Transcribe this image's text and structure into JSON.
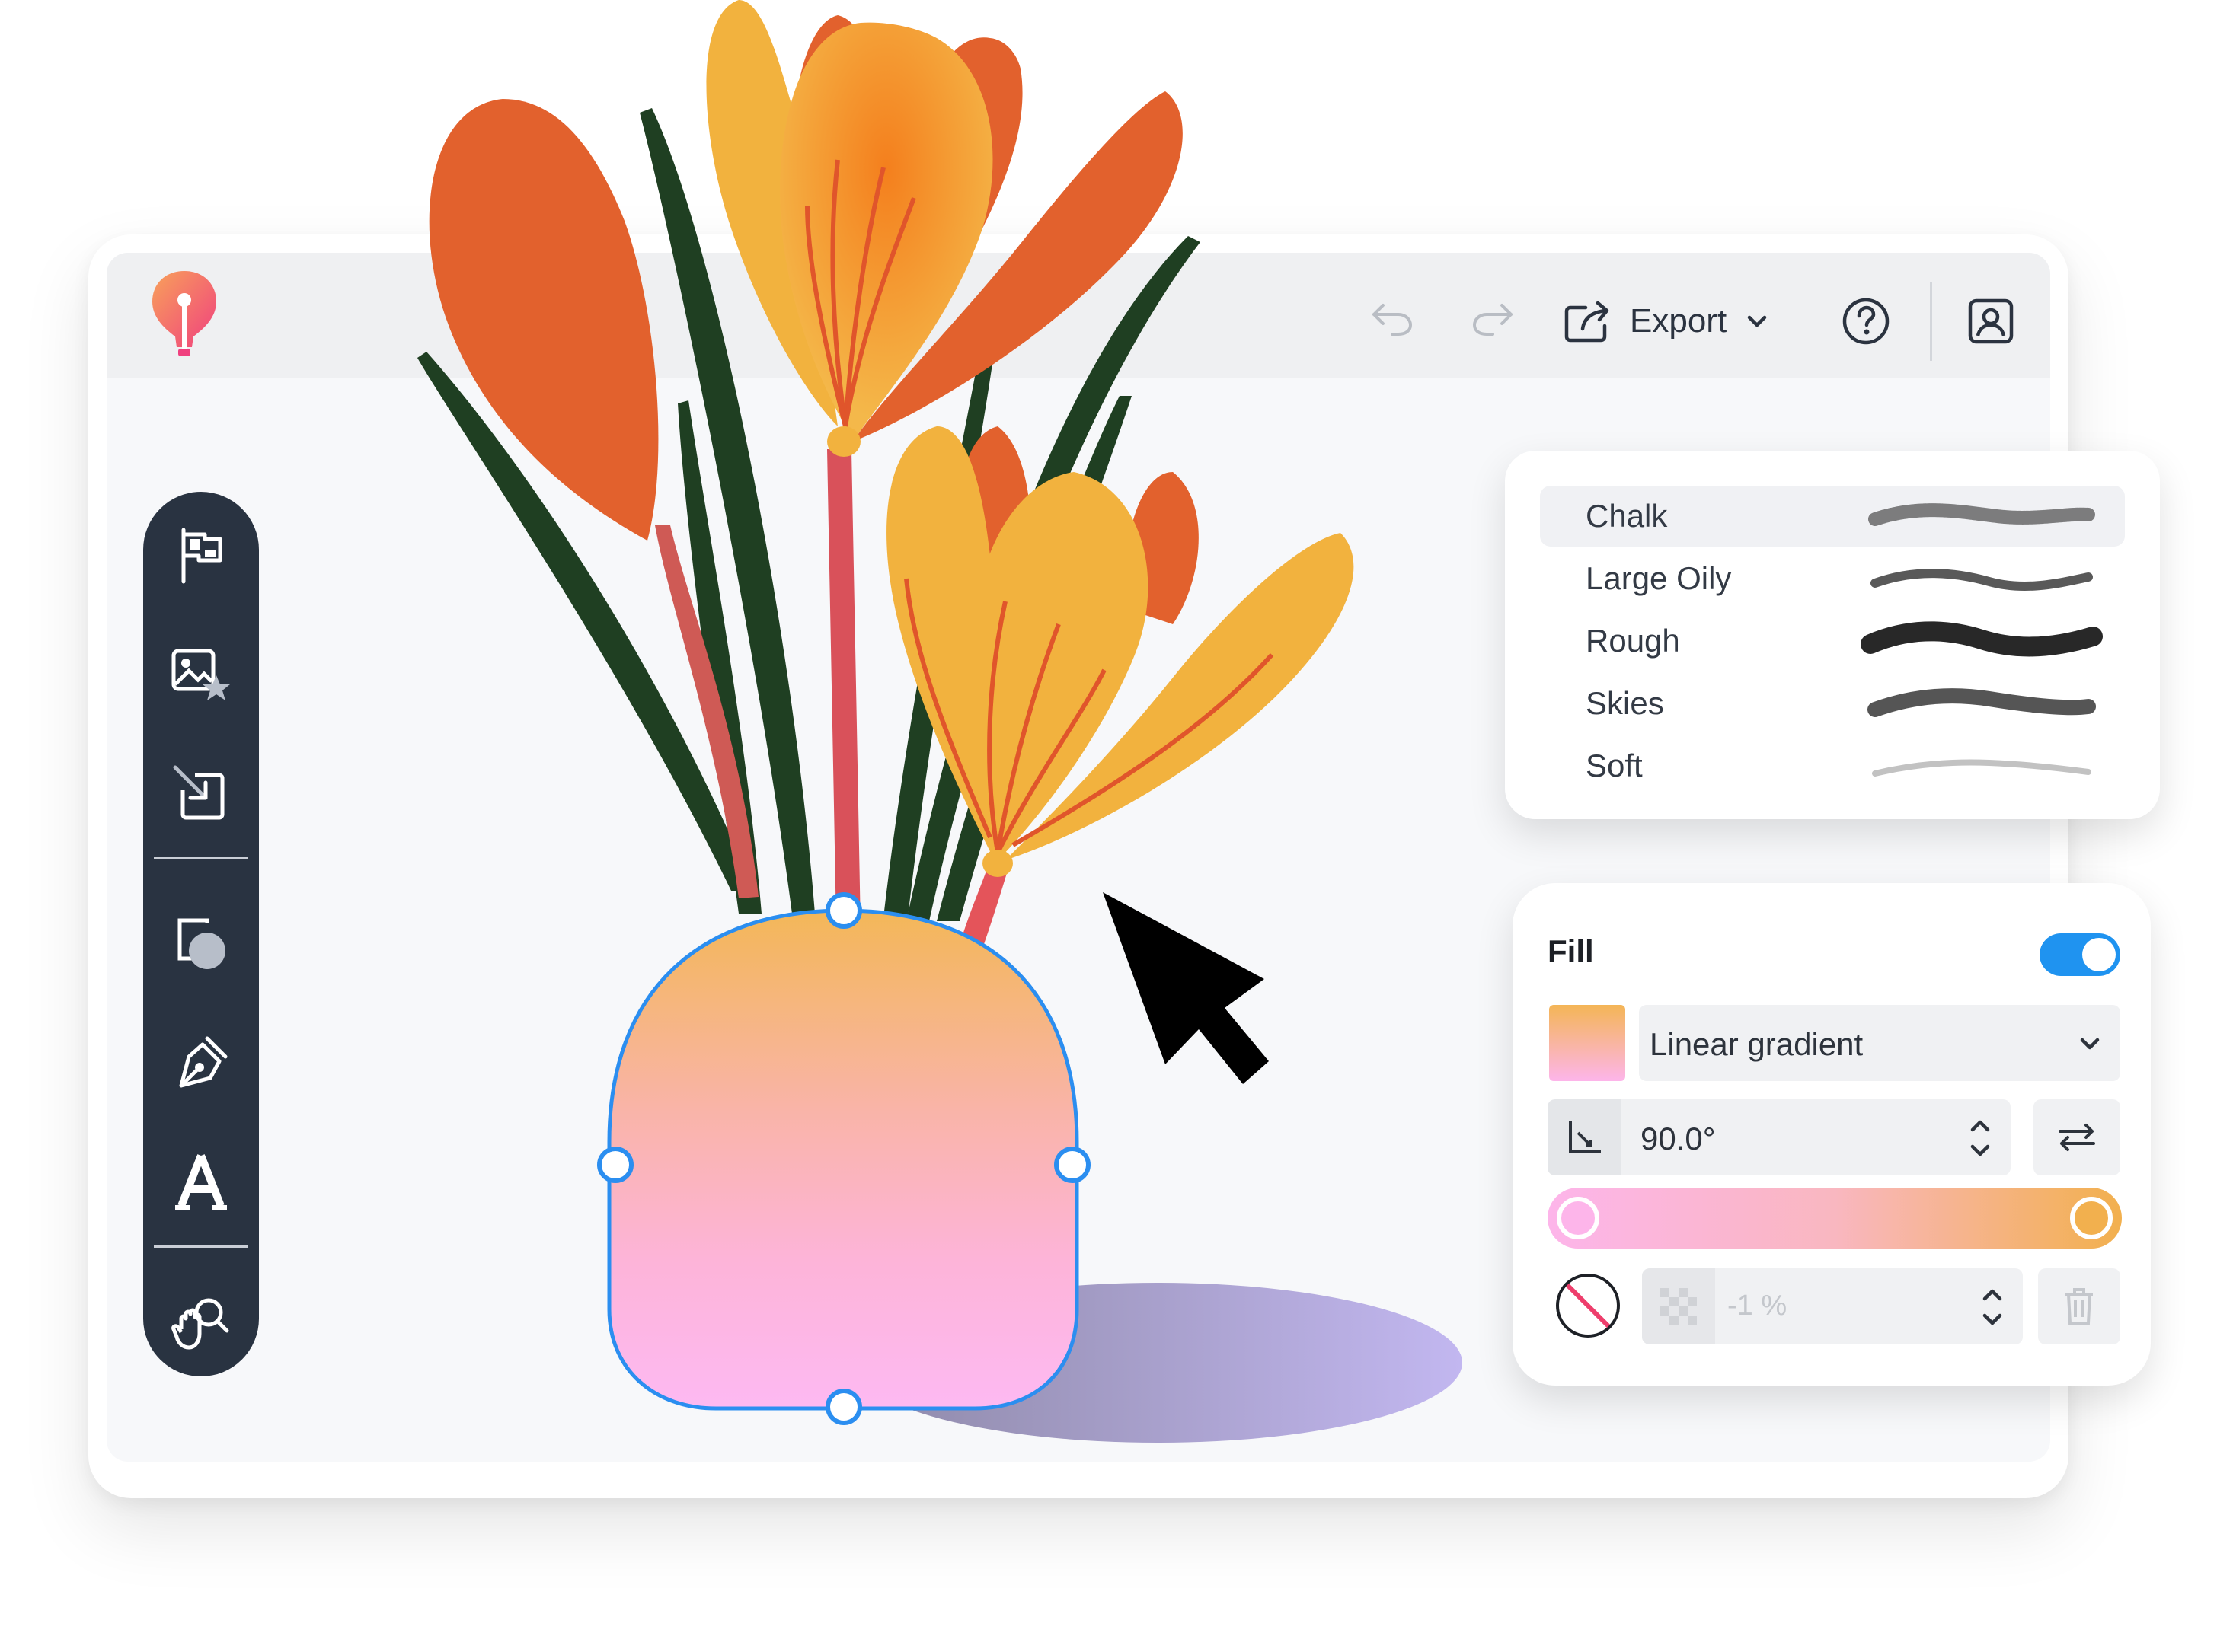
{
  "toolbar_top": {
    "export_label": "Export"
  },
  "brushes": [
    {
      "name": "Chalk",
      "selected": true
    },
    {
      "name": "Large Oily",
      "selected": false
    },
    {
      "name": "Rough",
      "selected": false
    },
    {
      "name": "Skies",
      "selected": false
    },
    {
      "name": "Soft",
      "selected": false
    }
  ],
  "fill": {
    "title": "Fill",
    "enabled": true,
    "type": "Linear gradient",
    "angle": "90.0°",
    "opacity": "-1 %",
    "gradient_start": "#fdb5ea",
    "gradient_end": "#f2b04e"
  },
  "colors": {
    "accent": "#1f93f0",
    "toolbar_bg": "#293341",
    "logo": "#f35a86"
  },
  "tools": [
    "flag-icon",
    "image-star-icon",
    "import-icon",
    "shape-icon",
    "pen-icon",
    "text-icon",
    "hand-zoom-icon"
  ]
}
